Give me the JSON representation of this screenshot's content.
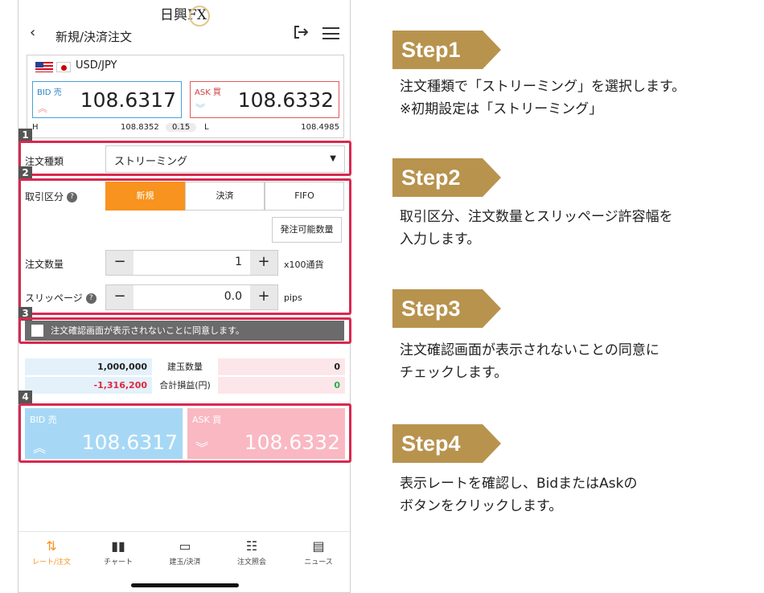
{
  "app": {
    "brand": "日興FX",
    "nav_title": "新規/決済注文",
    "back_icon": "‹"
  },
  "rate": {
    "pair": "USD/JPY",
    "bid_label": "BID 売",
    "ask_label": "ASK 買",
    "bid_price": "108.6317",
    "ask_price": "108.6332",
    "high_label": "H",
    "high_value": "108.8352",
    "spread": "0.15",
    "low_label": "L",
    "low_value": "108.4985"
  },
  "form": {
    "order_type_label": "注文種類",
    "order_type_value": "ストリーミング",
    "trade_type_label": "取引区分",
    "trade_types": [
      "新規",
      "決済",
      "FIFO"
    ],
    "active_trade_type": "新規",
    "available_qty_button": "発注可能数量",
    "qty_label": "注文数量",
    "qty_value": "1",
    "qty_unit": "x100通貨",
    "slippage_label": "スリッページ",
    "slippage_value": "0.0",
    "slippage_unit": "pips",
    "agree_text": "注文確認画面が表示されないことに同意します。",
    "agree_checked": false
  },
  "positions": {
    "bid_qty": "1,000,000",
    "qty_label": "建玉数量",
    "ask_qty": "0",
    "bid_pl": "-1,316,200",
    "pl_label": "合計損益(円)",
    "ask_pl": "0"
  },
  "big_buttons": {
    "bid_label": "BID 売",
    "bid_price": "108.6317",
    "ask_label": "ASK 買",
    "ask_price": "108.6332"
  },
  "step_tags": [
    "1",
    "2",
    "3",
    "4"
  ],
  "tabbar": [
    {
      "label": "レート/注文",
      "icon": "rate-order-icon",
      "active": true
    },
    {
      "label": "チャート",
      "icon": "chart-icon",
      "active": false
    },
    {
      "label": "建玉/決済",
      "icon": "position-icon",
      "active": false
    },
    {
      "label": "注文照会",
      "icon": "order-list-icon",
      "active": false
    },
    {
      "label": "ニュース",
      "icon": "news-icon",
      "active": false
    }
  ],
  "instructions": [
    {
      "title": "Step1",
      "lines": [
        "注文種類で「ストリーミング」を選択します。",
        "※初期設定は「ストリーミング」"
      ]
    },
    {
      "title": "Step2",
      "lines": [
        "取引区分、注文数量とスリッページ許容幅を",
        "入力します。"
      ]
    },
    {
      "title": "Step3",
      "lines": [
        "注文確認画面が表示されないことの同意に",
        "チェックします。"
      ]
    },
    {
      "title": "Step4",
      "lines": [
        "表示レートを確認し、BidまたはAskの",
        "ボタンをクリックします。"
      ]
    }
  ],
  "colors": {
    "accent_orange": "#f7931e",
    "step_gold": "#b8934e",
    "highlight_red": "#d8284f",
    "bid_blue": "#a6d8f5",
    "ask_pink": "#f9b8c2",
    "loss_red": "#e0283c",
    "gain_green": "#22b24c"
  }
}
